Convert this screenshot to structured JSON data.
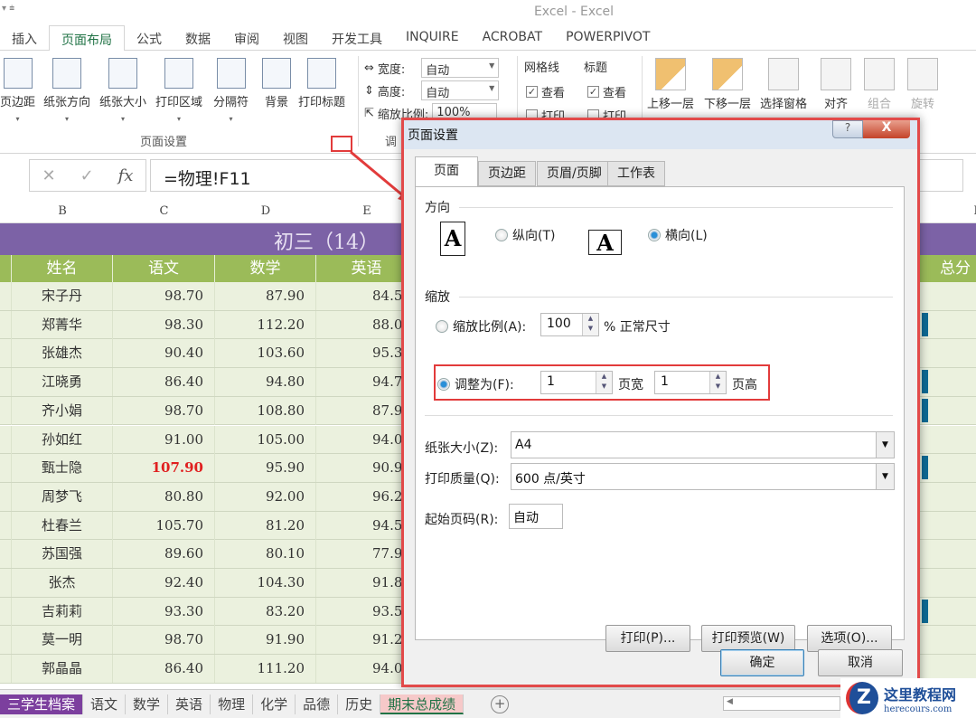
{
  "app": {
    "title": "Excel - Excel"
  },
  "ribbon_tabs": [
    "插入",
    "页面布局",
    "公式",
    "数据",
    "审阅",
    "视图",
    "开发工具",
    "INQUIRE",
    "ACROBAT",
    "POWERPIVOT"
  ],
  "active_tab": "页面布局",
  "page_setup_group": {
    "label": "页面设置",
    "buttons": [
      "页边距",
      "纸张方向",
      "纸张大小",
      "打印区域",
      "分隔符",
      "背景",
      "打印标题"
    ]
  },
  "scale_group": {
    "label": "调",
    "width_label": "宽度:",
    "width_value": "自动",
    "height_label": "高度:",
    "height_value": "自动",
    "scale_label": "缩放比例:",
    "scale_value": "100%"
  },
  "sheet_options": {
    "gridlines": "网格线",
    "headings": "标题",
    "view": "查看",
    "print": "打印"
  },
  "arrange_group": {
    "buttons": [
      "上移一层",
      "下移一层",
      "选择窗格",
      "对齐",
      "组合",
      "旋转"
    ]
  },
  "formula_bar": {
    "formula": "=物理!F11",
    "fx": "fx"
  },
  "columns": [
    "B",
    "C",
    "D",
    "E",
    "I"
  ],
  "sheet": {
    "banner": "初三（14）",
    "headers": [
      "姓名",
      "语文",
      "数学",
      "英语",
      "总分"
    ],
    "rows": [
      {
        "name": "宋子丹",
        "chinese": "98.70",
        "math": "87.90",
        "english": "84.5"
      },
      {
        "name": "郑菁华",
        "chinese": "98.30",
        "math": "112.20",
        "english": "88.0"
      },
      {
        "name": "张雄杰",
        "chinese": "90.40",
        "math": "103.60",
        "english": "95.3"
      },
      {
        "name": "江晓勇",
        "chinese": "86.40",
        "math": "94.80",
        "english": "94.7"
      },
      {
        "name": "齐小娟",
        "chinese": "98.70",
        "math": "108.80",
        "english": "87.9"
      },
      {
        "name": "孙如红",
        "chinese": "91.00",
        "math": "105.00",
        "english": "94.0"
      },
      {
        "name": "甄士隐",
        "chinese": "107.90",
        "math": "95.90",
        "english": "90.9",
        "highlight": true
      },
      {
        "name": "周梦飞",
        "chinese": "80.80",
        "math": "92.00",
        "english": "96.2"
      },
      {
        "name": "杜春兰",
        "chinese": "105.70",
        "math": "81.20",
        "english": "94.5"
      },
      {
        "name": "苏国强",
        "chinese": "89.60",
        "math": "80.10",
        "english": "77.9"
      },
      {
        "name": "张杰",
        "chinese": "92.40",
        "math": "104.30",
        "english": "91.8"
      },
      {
        "name": "吉莉莉",
        "chinese": "93.30",
        "math": "83.20",
        "english": "93.5"
      },
      {
        "name": "莫一明",
        "chinese": "98.70",
        "math": "91.90",
        "english": "91.2"
      },
      {
        "name": "郭晶晶",
        "chinese": "86.40",
        "math": "111.20",
        "english": "94.0"
      }
    ]
  },
  "sheet_tabs": [
    "三学生档案",
    "语文",
    "数学",
    "英语",
    "物理",
    "化学",
    "品德",
    "历史",
    "期末总成绩"
  ],
  "active_sheet": "期末总成绩",
  "dialog": {
    "title": "页面设置",
    "help": "?",
    "close": "X",
    "tabs": [
      "页面",
      "页边距",
      "页眉/页脚",
      "工作表"
    ],
    "orientation": {
      "label": "方向",
      "portrait": "纵向(T)",
      "landscape": "横向(L)",
      "selected": "landscape",
      "icon_letter": "A"
    },
    "scaling": {
      "label": "缩放",
      "adjust_label": "缩放比例(A):",
      "adjust_value": "100",
      "adjust_suffix": "% 正常尺寸",
      "fit_label": "调整为(F):",
      "fit_wide": "1",
      "fit_wide_suffix": "页宽",
      "fit_tall": "1",
      "fit_tall_suffix": "页高",
      "selected": "fit"
    },
    "paper_size": {
      "label": "纸张大小(Z):",
      "value": "A4"
    },
    "print_quality": {
      "label": "打印质量(Q):",
      "value": "600 点/英寸"
    },
    "first_page": {
      "label": "起始页码(R):",
      "value": "自动"
    },
    "buttons": {
      "print": "打印(P)...",
      "preview": "打印预览(W)",
      "options": "选项(O)...",
      "ok": "确定",
      "cancel": "取消"
    }
  },
  "watermark": {
    "name": "这里教程网",
    "url": "herecours.com"
  },
  "colors": {
    "banner": "#7c62a6",
    "header": "#9bbb59",
    "row": "#ebf1de",
    "highlight": "#e02020",
    "callout": "#e23b3b"
  }
}
